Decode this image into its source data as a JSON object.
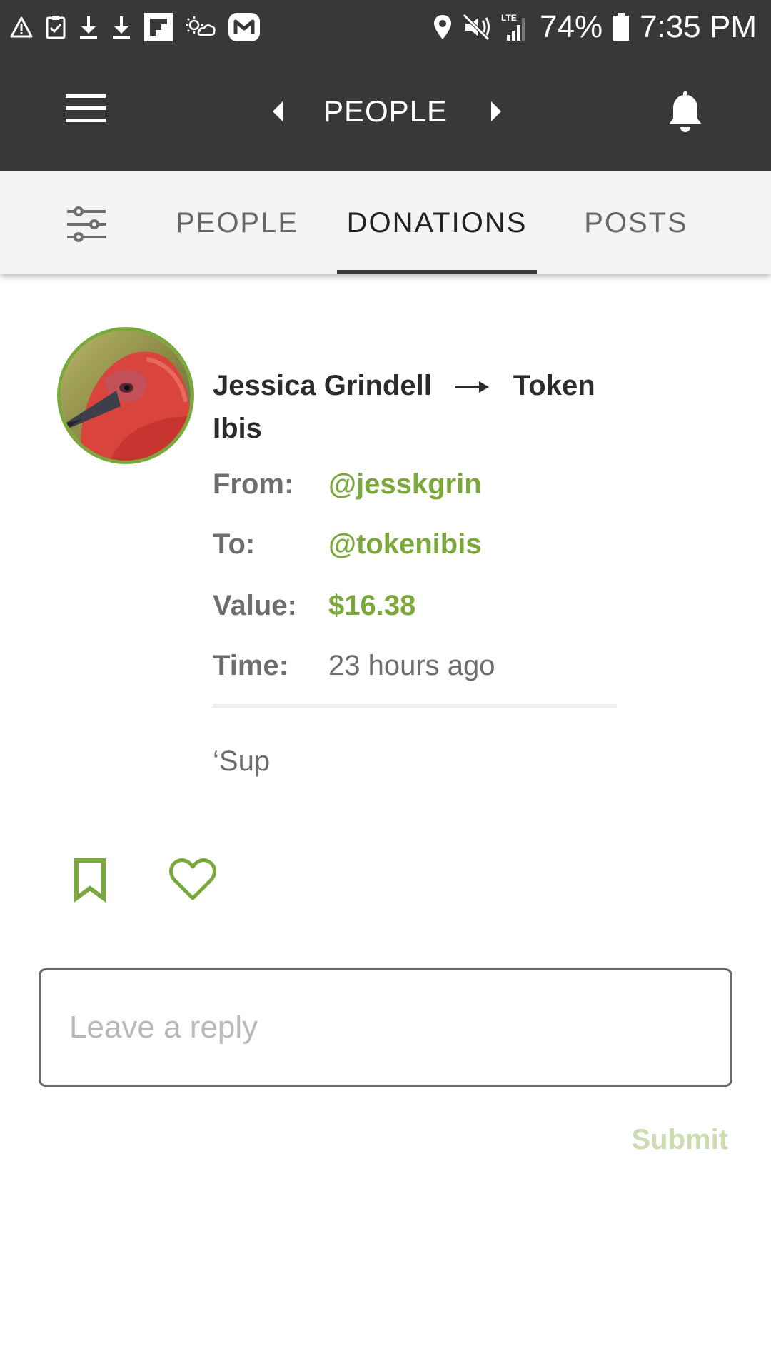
{
  "status_bar": {
    "battery_percent": "74%",
    "time": "7:35 PM",
    "network_label": "LTE",
    "left_icons": [
      "warning-icon",
      "clipboard-check-icon",
      "download-icon",
      "download-icon",
      "flipboard-icon",
      "weather-icon",
      "messenger-icon"
    ],
    "right_icons": [
      "location-icon",
      "mute-vibrate-icon",
      "signal-icon",
      "battery-icon"
    ]
  },
  "app_bar": {
    "title": "PEOPLE",
    "icons": [
      "menu-icon",
      "chevron-left-icon",
      "chevron-right-icon",
      "bell-icon"
    ]
  },
  "tabs": {
    "items": [
      {
        "label": "PEOPLE",
        "selected": false
      },
      {
        "label": "DONATIONS",
        "selected": true
      },
      {
        "label": "POSTS",
        "selected": false
      }
    ],
    "filter_icon": "sliders-icon"
  },
  "donation": {
    "sender_name": "Jessica Grindell",
    "recipient_name": "Token Ibis",
    "from_label": "From:",
    "from_value": "@jesskgrin",
    "to_label": "To:",
    "to_value": "@tokenibis",
    "value_label": "Value:",
    "value_value": "$16.38",
    "time_label": "Time:",
    "time_value": "23 hours ago",
    "message": "‘Sup"
  },
  "actions": {
    "icons": [
      "bookmark-icon",
      "heart-icon"
    ]
  },
  "reply": {
    "placeholder": "Leave a reply",
    "value": "",
    "submit_label": "Submit"
  },
  "colors": {
    "accent": "#7aa83a",
    "app_bar": "#383838",
    "tab_bar": "#f4f4f4",
    "submit_disabled": "#cbdcaf"
  }
}
